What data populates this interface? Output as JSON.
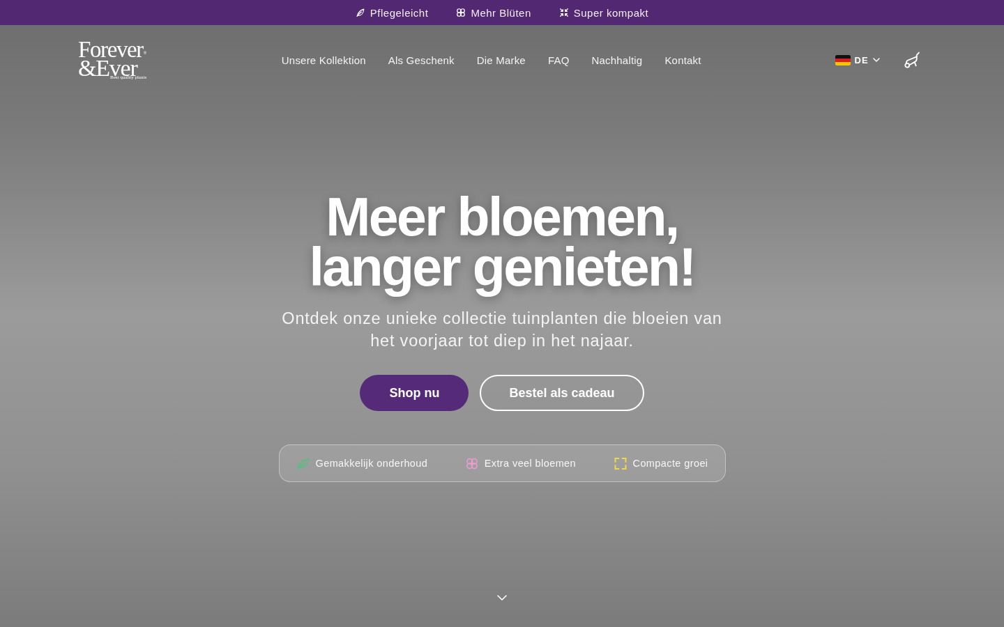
{
  "top_bar": {
    "items": [
      {
        "kind": "leaf",
        "label": "Pflegeleicht"
      },
      {
        "kind": "flower",
        "label": "Mehr Blüten"
      },
      {
        "kind": "compress",
        "label": "Super kompakt"
      }
    ]
  },
  "header": {
    "logo": {
      "line1": "Forever",
      "mark": "®",
      "line2": "&Ever",
      "tagline": "Best quality plants"
    },
    "nav": [
      "Unsere Kollektion",
      "Als Geschenk",
      "Die Marke",
      "FAQ",
      "Nachhaltig",
      "Kontakt"
    ],
    "language": {
      "code": "DE"
    }
  },
  "hero": {
    "title_lines": [
      "Meer bloemen,",
      "langer genieten!"
    ],
    "subtitle": "Ontdek onze unieke collectie tuinplanten die bloeien van het voorjaar tot diep in het najaar.",
    "buttons": [
      {
        "kind": "primary",
        "label": "Shop nu"
      },
      {
        "kind": "outline",
        "label": "Bestel als cadeau"
      }
    ],
    "features": [
      {
        "kind": "leaf",
        "label": "Gemakkelijk onderhoud",
        "color": "#4fc27c"
      },
      {
        "kind": "flower",
        "label": "Extra veel bloemen",
        "color": "#f09ad0"
      },
      {
        "kind": "corners",
        "label": "Compacte groei",
        "color": "#ecd84a"
      }
    ]
  }
}
